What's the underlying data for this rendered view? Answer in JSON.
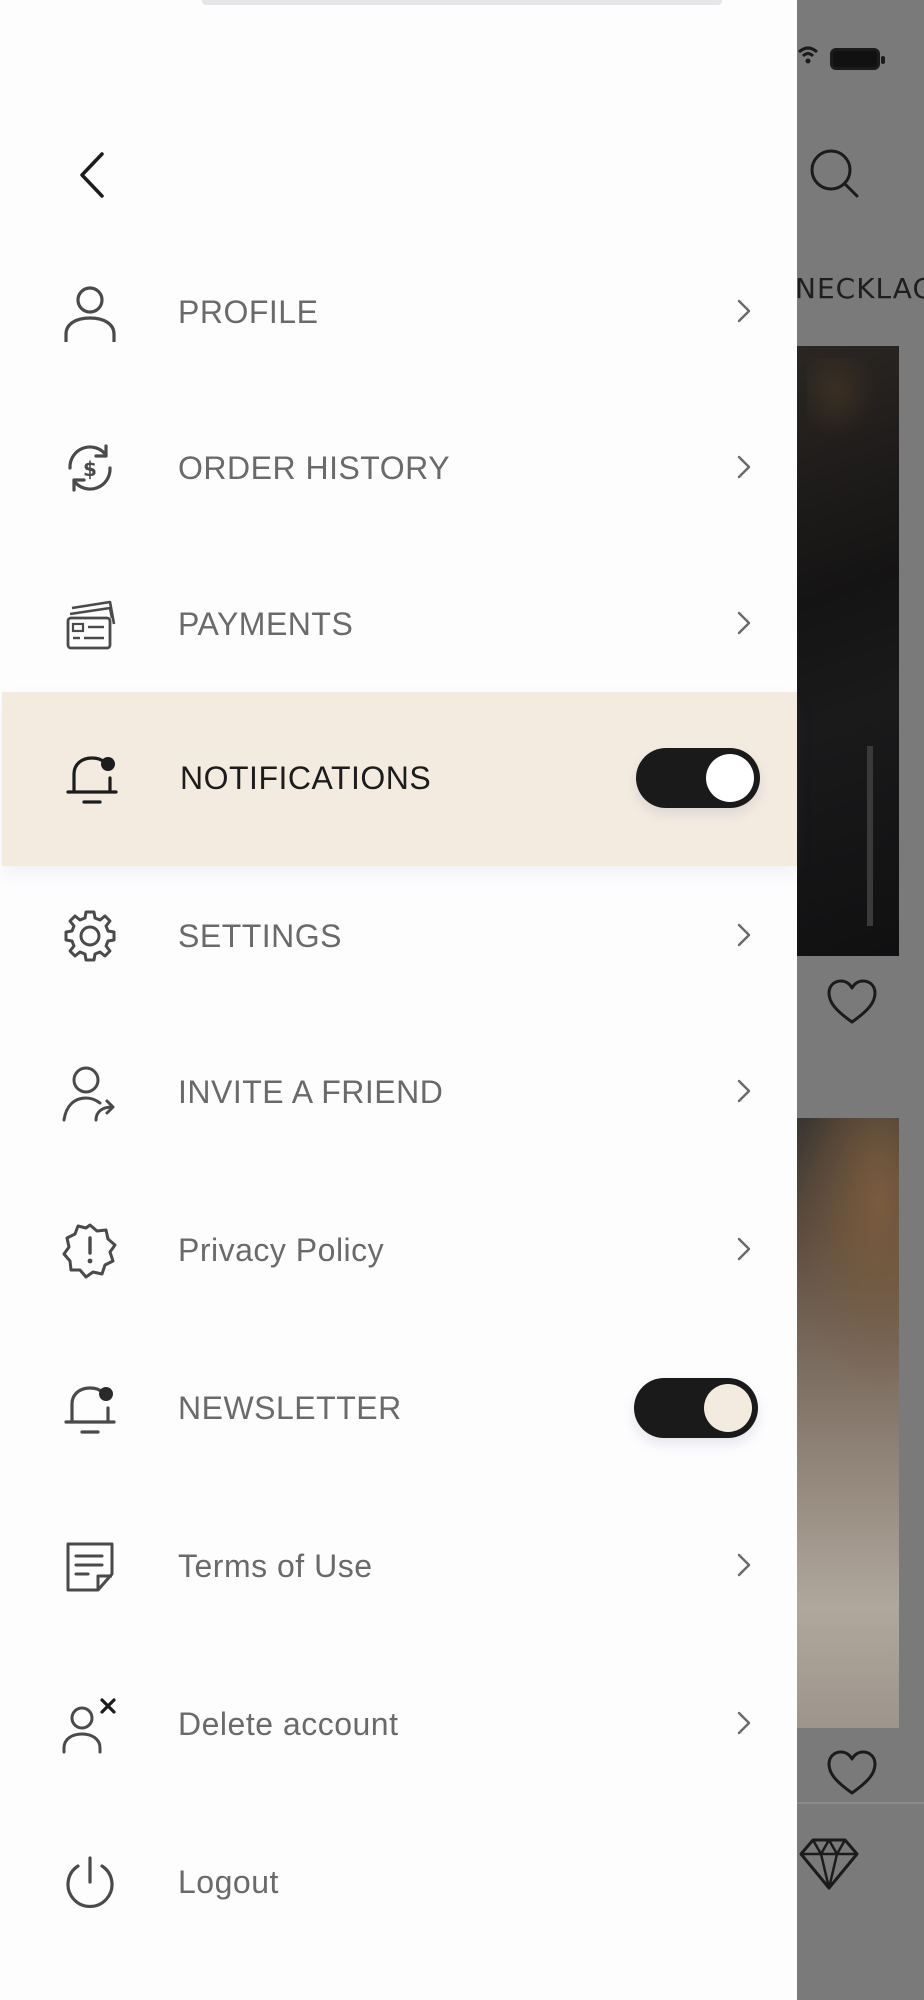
{
  "background_app": {
    "category_label": "NECKLACE",
    "icons": [
      "wifi-icon",
      "battery-icon",
      "search-icon",
      "heart-icon",
      "heart-icon",
      "diamond-icon"
    ]
  },
  "drawer": {
    "back_icon": "chevron-left-icon",
    "items": [
      {
        "label": "PROFILE",
        "icon": "user-icon",
        "control": "chevron"
      },
      {
        "label": "ORDER HISTORY",
        "icon": "dollar-cycle-icon",
        "control": "chevron"
      },
      {
        "label": "PAYMENTS",
        "icon": "credit-card-icon",
        "control": "chevron"
      },
      {
        "label": "NOTIFICATIONS",
        "icon": "bell-icon",
        "control": "toggle",
        "toggle_on": true,
        "active": true
      },
      {
        "label": "SETTINGS",
        "icon": "gear-icon",
        "control": "chevron"
      },
      {
        "label": "INVITE A FRIEND",
        "icon": "user-share-icon",
        "control": "chevron"
      },
      {
        "label": "Privacy Policy",
        "icon": "alert-badge-icon",
        "control": "chevron"
      },
      {
        "label": "NEWSLETTER",
        "icon": "bell-icon",
        "control": "toggle",
        "toggle_on": true
      },
      {
        "label": "Terms of Use",
        "icon": "document-icon",
        "control": "chevron"
      },
      {
        "label": "Delete account",
        "icon": "user-remove-icon",
        "control": "chevron"
      },
      {
        "label": "Logout",
        "icon": "power-icon",
        "control": "none"
      }
    ]
  },
  "colors": {
    "active_row_bg": "#f4ebe0",
    "toggle_track": "#1a1a1a",
    "toggle_knob_notifications": "#ffffff",
    "toggle_knob_newsletter": "#f4ebe0",
    "overlay": "#7a7a7a"
  }
}
